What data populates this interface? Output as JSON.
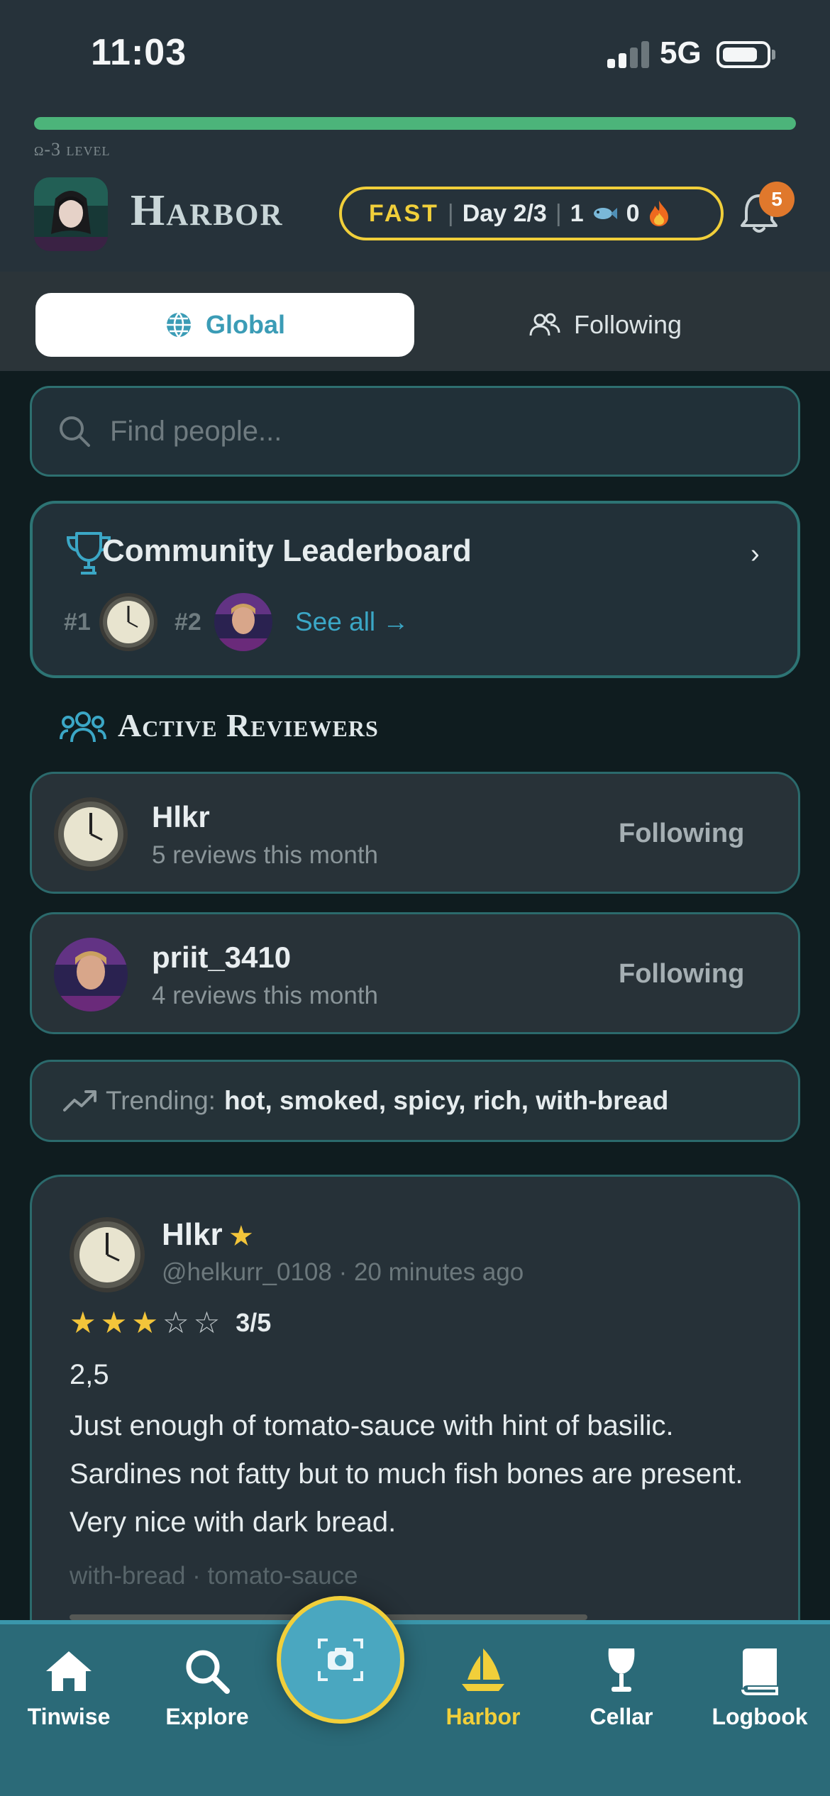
{
  "status_bar": {
    "time": "11:03",
    "network": "5G"
  },
  "level": {
    "label": "ω-3 level",
    "progress": 1.0
  },
  "header": {
    "title": "Harbor",
    "fast_pill": {
      "mode": "FAST",
      "day": "Day 2/3",
      "fish_count": "1",
      "flame_count": "0"
    },
    "notifications": {
      "badge": "5"
    }
  },
  "tabs": [
    {
      "label": "Global",
      "icon": "globe-icon",
      "active": true
    },
    {
      "label": "Following",
      "icon": "people-icon",
      "active": false
    }
  ],
  "search": {
    "placeholder": "Find people..."
  },
  "leaderboard": {
    "title": "Community Leaderboard",
    "ranks": [
      {
        "rank": "#1"
      },
      {
        "rank": "#2"
      }
    ],
    "see_all": "See all →"
  },
  "section": {
    "title": "Active Reviewers"
  },
  "reviewers": [
    {
      "name": "Hlkr",
      "subtitle": "5 reviews this month",
      "action": "Following"
    },
    {
      "name": "priit_3410",
      "subtitle": "4 reviews this month",
      "action": "Following"
    }
  ],
  "trending": {
    "label": "Trending:",
    "tags": "hot, smoked, spicy, rich, with-bread"
  },
  "post": {
    "author": "Hlkr",
    "meta": "@helkurr_0108 · 20 minutes ago",
    "rating_value": 3,
    "rating_max": 5,
    "rating_text": "3/5",
    "score": "2,5",
    "body": "Just enough of tomato-sauce with hint of basilic. Sardines not fatty but to much fish bones are present. Very nice with dark bread.",
    "tags": "with-bread · tomato-sauce"
  },
  "bottom_nav": [
    {
      "label": "Tinwise",
      "icon": "home-icon",
      "active": false
    },
    {
      "label": "Explore",
      "icon": "search-icon",
      "active": false
    },
    {
      "label": "Harbor",
      "icon": "sailboat-icon",
      "active": true
    },
    {
      "label": "Cellar",
      "icon": "wine-glass-icon",
      "active": false
    },
    {
      "label": "Logbook",
      "icon": "book-icon",
      "active": false
    }
  ],
  "colors": {
    "accent_yellow": "#f1cf3a",
    "accent_teal": "#3ba7c6",
    "level_green": "#4cb47a",
    "badge_orange": "#e0782c"
  }
}
